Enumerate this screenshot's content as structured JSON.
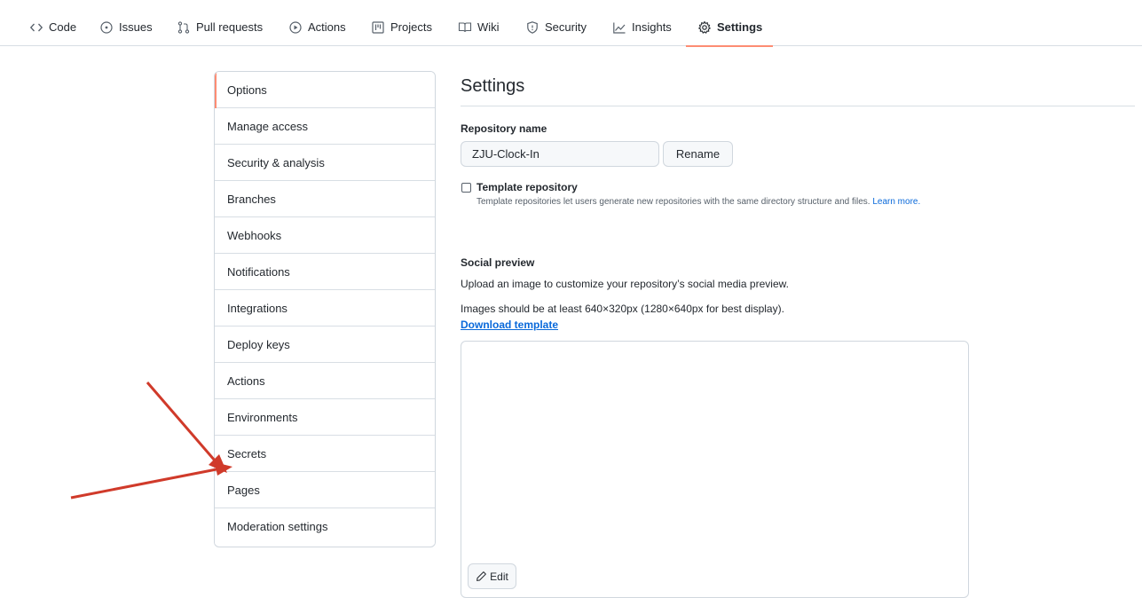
{
  "nav": {
    "tabs": [
      {
        "label": "Code",
        "icon": "code-icon"
      },
      {
        "label": "Issues",
        "icon": "issue-opened-icon"
      },
      {
        "label": "Pull requests",
        "icon": "git-pull-request-icon"
      },
      {
        "label": "Actions",
        "icon": "play-icon"
      },
      {
        "label": "Projects",
        "icon": "project-icon"
      },
      {
        "label": "Wiki",
        "icon": "book-icon"
      },
      {
        "label": "Security",
        "icon": "shield-icon"
      },
      {
        "label": "Insights",
        "icon": "graph-icon"
      },
      {
        "label": "Settings",
        "icon": "gear-icon",
        "selected": true
      }
    ]
  },
  "menu": {
    "items": [
      {
        "label": "Options",
        "active": true
      },
      {
        "label": "Manage access"
      },
      {
        "label": "Security & analysis"
      },
      {
        "label": "Branches"
      },
      {
        "label": "Webhooks"
      },
      {
        "label": "Notifications"
      },
      {
        "label": "Integrations"
      },
      {
        "label": "Deploy keys"
      },
      {
        "label": "Actions"
      },
      {
        "label": "Environments"
      },
      {
        "label": "Secrets"
      },
      {
        "label": "Pages"
      },
      {
        "label": "Moderation settings"
      }
    ]
  },
  "main": {
    "title": "Settings",
    "repo_name": {
      "label": "Repository name",
      "value": "ZJU-Clock-In",
      "rename_button": "Rename"
    },
    "template": {
      "label": "Template repository",
      "description": "Template repositories let users generate new repositories with the same directory structure and files.",
      "learn_more": "Learn more.",
      "checked": false
    },
    "social_preview": {
      "title": "Social preview",
      "description": "Upload an image to customize your repository’s social media preview.",
      "size_note": "Images should be at least 640×320px (1280×640px for best display).",
      "download_link": "Download template",
      "edit_button": "Edit"
    }
  },
  "colors": {
    "accent_underline": "#fd8c73",
    "link": "#0969da",
    "annotation_arrow": "#d03a2a"
  }
}
